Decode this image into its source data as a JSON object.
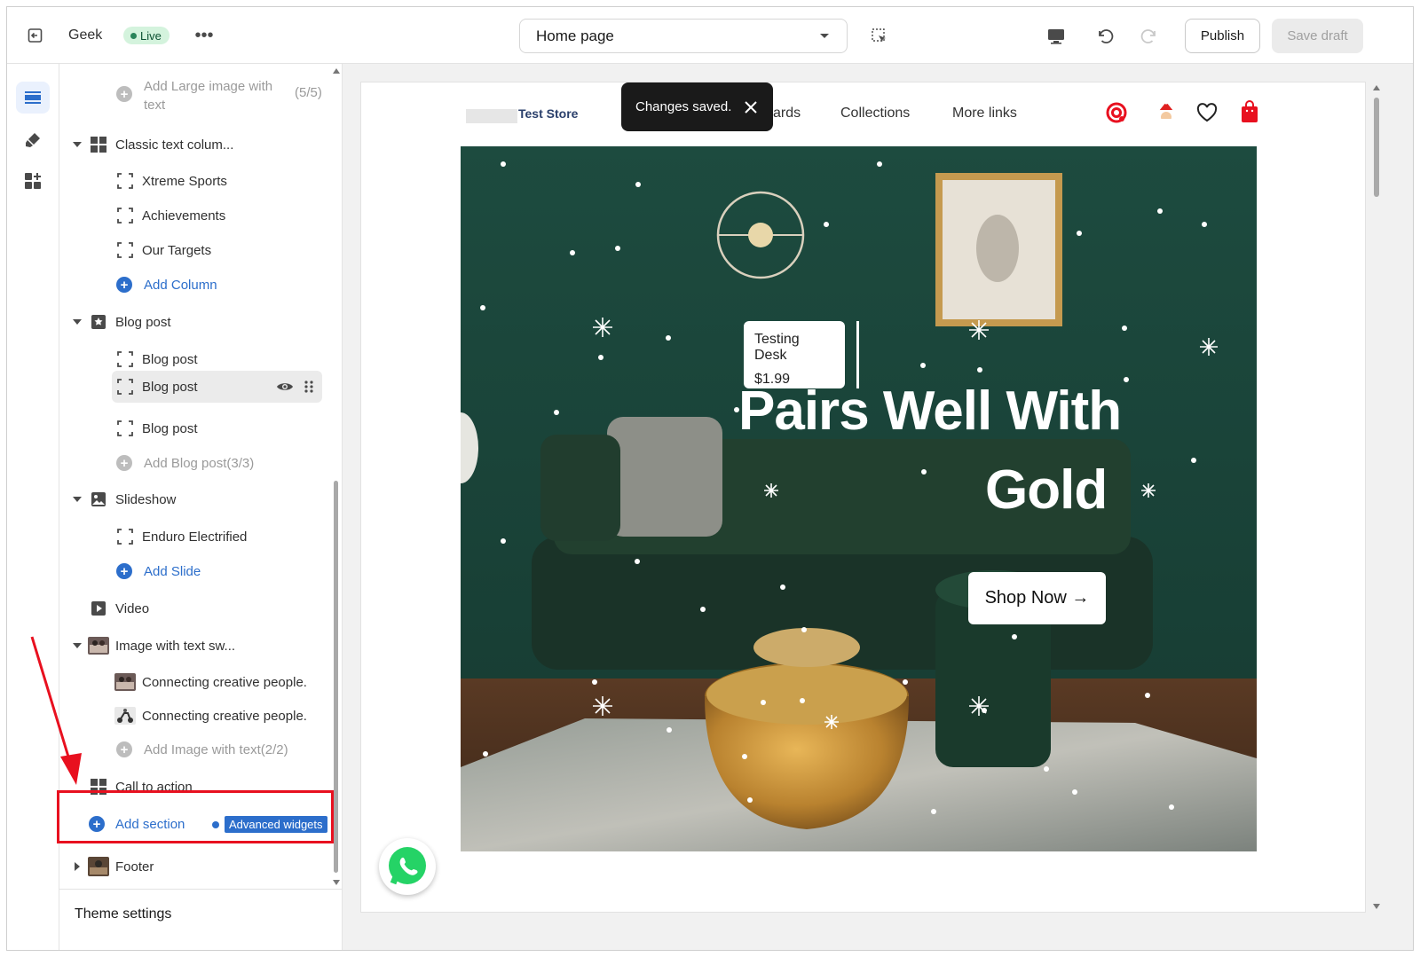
{
  "topbar": {
    "store_name": "Geek",
    "live_badge": "Live",
    "page_select": "Home page",
    "publish_label": "Publish",
    "save_draft_label": "Save draft"
  },
  "sidebar": {
    "items": [
      {
        "kind": "add",
        "label": "Add Large image with text",
        "count": "(5/5)"
      },
      {
        "kind": "section",
        "label": "Classic text colum..."
      },
      {
        "kind": "block",
        "label": "Xtreme Sports"
      },
      {
        "kind": "block",
        "label": "Achievements"
      },
      {
        "kind": "block",
        "label": "Our Targets"
      },
      {
        "kind": "add",
        "label": "Add Column"
      },
      {
        "kind": "section",
        "label": "Blog post"
      },
      {
        "kind": "block",
        "label": "Blog post"
      },
      {
        "kind": "block",
        "label": "Blog post"
      },
      {
        "kind": "block",
        "label": "Blog post"
      },
      {
        "kind": "add",
        "label": "Add Blog post(3/3)"
      },
      {
        "kind": "section",
        "label": "Slideshow"
      },
      {
        "kind": "block",
        "label": "Enduro Electrified"
      },
      {
        "kind": "add",
        "label": "Add Slide"
      },
      {
        "kind": "section",
        "label": "Video"
      },
      {
        "kind": "section",
        "label": "Image with text sw..."
      },
      {
        "kind": "block",
        "label": "Connecting creative people."
      },
      {
        "kind": "block",
        "label": "Connecting creative people."
      },
      {
        "kind": "add",
        "label": "Add Image with text(2/2)"
      },
      {
        "kind": "section",
        "label": "Call to action"
      },
      {
        "kind": "add",
        "label": "Add section"
      },
      {
        "kind": "badge",
        "label": "Advanced widgets"
      },
      {
        "kind": "section",
        "label": "Footer"
      }
    ],
    "theme_settings": "Theme settings"
  },
  "preview": {
    "toast": "Changes saved.",
    "store_logo_text": "Test Store",
    "nav": [
      "ards",
      "Collections",
      "More links"
    ],
    "price_card": {
      "name": "Testing Desk",
      "price": "$1.99"
    },
    "headline_line1": "Pairs Well With",
    "headline_line2": "Gold",
    "cta_label": "Shop Now →"
  },
  "colors": {
    "accent_blue": "#2c6ecb",
    "live_green": "#29845a",
    "hero_green": "#1f4a3e",
    "highlight_red": "#e8101f"
  }
}
